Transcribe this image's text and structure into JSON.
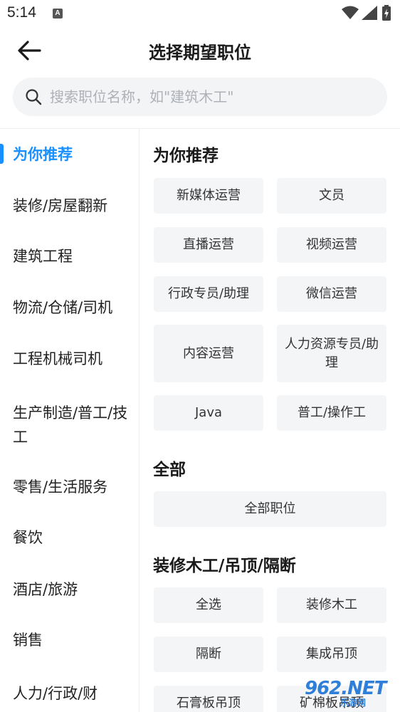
{
  "status": {
    "time": "5:14",
    "notif_letter": "A"
  },
  "header": {
    "title": "选择期望职位"
  },
  "search": {
    "placeholder": "搜索职位名称，如\"建筑木工\""
  },
  "sidebar": {
    "items": [
      {
        "label": "为你推荐"
      },
      {
        "label": "装修/房屋翻新"
      },
      {
        "label": "建筑工程"
      },
      {
        "label": "物流/仓储/司机"
      },
      {
        "label": "工程机械司机"
      },
      {
        "label": "生产制造/普工/技工"
      },
      {
        "label": "零售/生活服务"
      },
      {
        "label": "餐饮"
      },
      {
        "label": "酒店/旅游"
      },
      {
        "label": "销售"
      },
      {
        "label": "人力/行政/财"
      }
    ]
  },
  "sections": {
    "recommend": {
      "title": "为你推荐",
      "chips": [
        "新媒体运营",
        "文员",
        "直播运营",
        "视频运营",
        "行政专员/助理",
        "微信运营",
        "内容运营",
        "人力资源专员/助理",
        "Java",
        "普工/操作工"
      ]
    },
    "all": {
      "title": "全部",
      "chips": [
        "全部职位"
      ]
    },
    "carpentry": {
      "title": "装修木工/吊顶/隔断",
      "chips": [
        "全选",
        "装修木工",
        "隔断",
        "集成吊顶",
        "石膏板吊顶",
        "矿棉板吊顶"
      ]
    }
  },
  "watermark": {
    "text": "962.NET",
    "sub": "乐游网"
  }
}
